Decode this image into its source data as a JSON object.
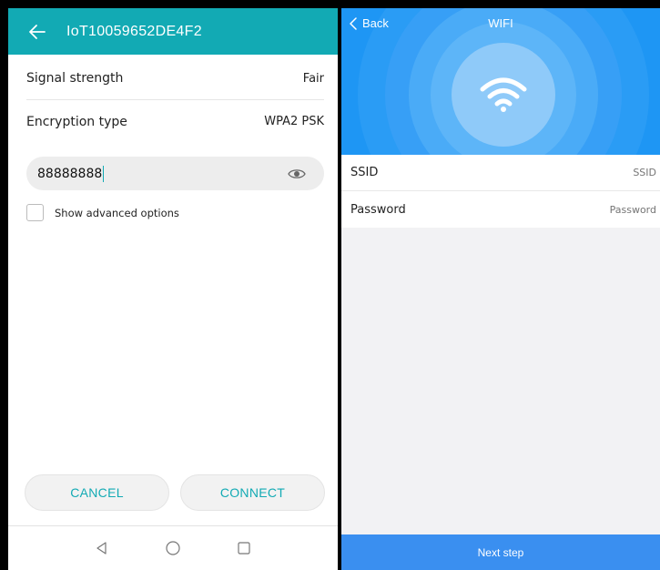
{
  "left_screen": {
    "header": {
      "title": "IoT10059652DE4F2",
      "back_icon": "arrow-left-icon"
    },
    "signal": {
      "label": "Signal strength",
      "value": "Fair"
    },
    "encryption": {
      "label": "Encryption type",
      "value": "WPA2 PSK"
    },
    "password": {
      "value": "88888888",
      "toggle_icon": "eye-icon"
    },
    "advanced": {
      "label": "Show advanced options",
      "checked": false
    },
    "buttons": {
      "cancel": "CANCEL",
      "connect": "CONNECT"
    },
    "navbar": {
      "icons": [
        "back-triangle-icon",
        "home-circle-icon",
        "recents-square-icon"
      ]
    },
    "colors": {
      "accent": "#12aab4"
    }
  },
  "right_screen": {
    "header": {
      "back_label": "Back",
      "title": "WIFI",
      "icon": "wifi-icon"
    },
    "form": {
      "ssid": {
        "label": "SSID",
        "placeholder": "SSID"
      },
      "password": {
        "label": "Password",
        "placeholder": "Password"
      }
    },
    "next_label": "Next step",
    "colors": {
      "header": "#1e96f4",
      "button": "#3a8ff0"
    }
  }
}
